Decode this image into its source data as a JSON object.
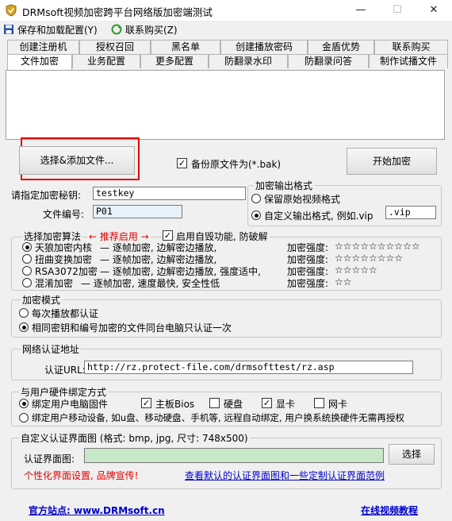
{
  "window": {
    "title": "DRMsoft视频加密跨平台网络版加密端测试"
  },
  "toolbar": {
    "save_label": "保存和加载配置(Y)",
    "contact_label": "联系购买(Z)"
  },
  "tabs_row1": [
    "创建注册机",
    "授权召回",
    "黑名单",
    "创建播放密码",
    "金盾优势",
    "联系购买"
  ],
  "tabs_row2": [
    "文件加密",
    "业务配置",
    "更多配置",
    "防翻录水印",
    "防翻录问答",
    "制作试播文件"
  ],
  "file": {
    "select_button": "选择&添加文件...",
    "backup_label": "备份原文件为(*.bak)",
    "start_button": "开始加密"
  },
  "key": {
    "label": "请指定加密秘钥:",
    "value": "testkey"
  },
  "fileno": {
    "label": "文件编号:",
    "value": "P01"
  },
  "output_format": {
    "title": "加密输出格式",
    "keep_label": "保留原始视频格式",
    "custom_label": "自定义输出格式, 例如.vip",
    "custom_value": ".vip"
  },
  "algorithms": {
    "title": "选择加密算法",
    "recommend": "← 推荐启用 →",
    "self_destruct": "启用自毁功能, 防破解",
    "items": [
      {
        "name": "天狼加密内核",
        "desc": "— 逐帧加密, 边解密边播放,",
        "strength_label": "加密强度:",
        "stars": "☆☆☆☆☆☆☆☆☆☆"
      },
      {
        "name": "扭曲变换加密",
        "desc": "— 逐帧加密, 边解密边播放,",
        "strength_label": "加密强度:",
        "stars": "☆☆☆☆☆☆☆☆"
      },
      {
        "name": "RSA3072加密",
        "desc": "— 逐帧加密, 边解密边播放, 强度适中,",
        "strength_label": "加密强度:",
        "stars": "☆☆☆☆☆"
      },
      {
        "name": "混淆加密",
        "desc": "— 逐帧加密, 速度最快, 安全性低",
        "strength_label": "加密强度:",
        "stars": "☆☆"
      }
    ]
  },
  "mode": {
    "title": "加密模式",
    "option1": "每次播放都认证",
    "option2": "相同密钥和编号加密的文件同台电脑只认证一次"
  },
  "network": {
    "title": "网络认证地址",
    "label": "认证URL:",
    "url": "http://rz.protect-file.com/drmsofttest/rz.asp"
  },
  "hardware": {
    "title": "与用户硬件绑定方式",
    "bind_pc": "绑定用户电脑固件",
    "motherboard": "主板Bios",
    "disk": "硬盘",
    "gpu": "显卡",
    "nic": "网卡",
    "bind_mobile": "绑定用户移动设备, 如u盘、移动硬盘、手机等, 远程自动绑定, 用户换系统换硬件无需再授权"
  },
  "auth_image": {
    "title": "自定义认证界面图 (格式: bmp, jpg, 尺寸: 748x500)",
    "label": "认证界面图:",
    "value": "",
    "browse_button": "选择",
    "slogan": "个性化界面设置, 品牌宣传!",
    "sample_link": "查看默认的认证界面图和一些定制认证界面范例"
  },
  "footer": {
    "site_label": "官方站点: www.DRMsoft.cn",
    "tutorial_label": "在线视频教程"
  },
  "colors": {
    "highlight_box": "#e00000",
    "link": "#0000cc",
    "input_green": "#c9e7c9",
    "input_blue": "#e6f2fb"
  }
}
